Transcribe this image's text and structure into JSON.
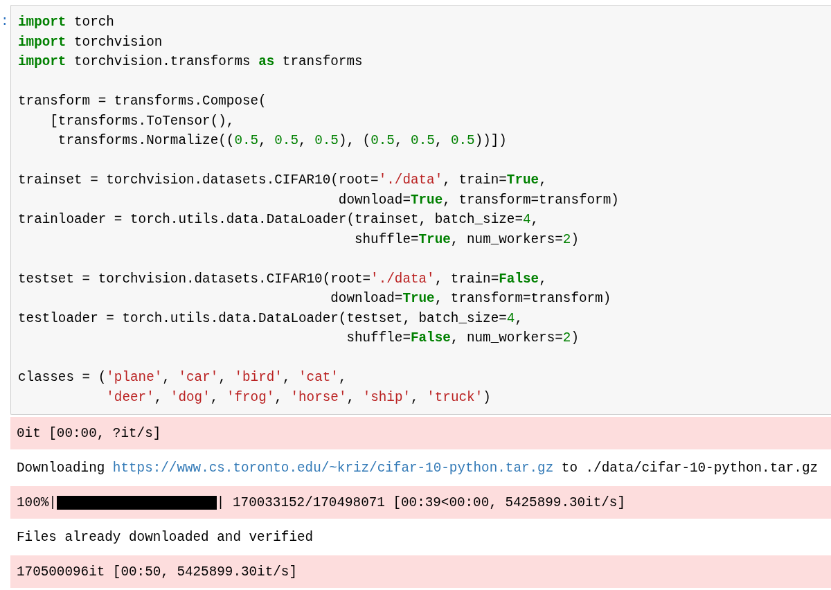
{
  "prompt": ":",
  "code_blocks": [
    [
      [
        {
          "t": "import",
          "kind": "keyword"
        },
        {
          "t": " torch",
          "kind": "plain"
        }
      ],
      [
        {
          "t": "import",
          "kind": "keyword"
        },
        {
          "t": " torchvision",
          "kind": "plain"
        }
      ],
      [
        {
          "t": "import",
          "kind": "keyword"
        },
        {
          "t": " torchvision.transforms ",
          "kind": "plain"
        },
        {
          "t": "as",
          "kind": "keyword"
        },
        {
          "t": " transforms",
          "kind": "plain"
        }
      ]
    ],
    [
      [
        {
          "t": "transform = transforms.Compose(",
          "kind": "plain"
        }
      ],
      [
        {
          "t": "    [transforms.ToTensor(),",
          "kind": "plain"
        }
      ],
      [
        {
          "t": "     transforms.Normalize((",
          "kind": "plain"
        },
        {
          "t": "0.5",
          "kind": "number"
        },
        {
          "t": ", ",
          "kind": "plain"
        },
        {
          "t": "0.5",
          "kind": "number"
        },
        {
          "t": ", ",
          "kind": "plain"
        },
        {
          "t": "0.5",
          "kind": "number"
        },
        {
          "t": "), (",
          "kind": "plain"
        },
        {
          "t": "0.5",
          "kind": "number"
        },
        {
          "t": ", ",
          "kind": "plain"
        },
        {
          "t": "0.5",
          "kind": "number"
        },
        {
          "t": ", ",
          "kind": "plain"
        },
        {
          "t": "0.5",
          "kind": "number"
        },
        {
          "t": "))])",
          "kind": "plain"
        }
      ]
    ],
    [
      [
        {
          "t": "trainset = torchvision.datasets.CIFAR10(root=",
          "kind": "plain"
        },
        {
          "t": "'./data'",
          "kind": "string"
        },
        {
          "t": ", train=",
          "kind": "plain"
        },
        {
          "t": "True",
          "kind": "keyword"
        },
        {
          "t": ",",
          "kind": "plain"
        }
      ],
      [
        {
          "t": "                                        download=",
          "kind": "plain"
        },
        {
          "t": "True",
          "kind": "keyword"
        },
        {
          "t": ", transform=transform)",
          "kind": "plain"
        }
      ],
      [
        {
          "t": "trainloader = torch.utils.data.DataLoader(trainset, batch_size=",
          "kind": "plain"
        },
        {
          "t": "4",
          "kind": "number"
        },
        {
          "t": ",",
          "kind": "plain"
        }
      ],
      [
        {
          "t": "                                          shuffle=",
          "kind": "plain"
        },
        {
          "t": "True",
          "kind": "keyword"
        },
        {
          "t": ", num_workers=",
          "kind": "plain"
        },
        {
          "t": "2",
          "kind": "number"
        },
        {
          "t": ")",
          "kind": "plain"
        }
      ]
    ],
    [
      [
        {
          "t": "testset = torchvision.datasets.CIFAR10(root=",
          "kind": "plain"
        },
        {
          "t": "'./data'",
          "kind": "string"
        },
        {
          "t": ", train=",
          "kind": "plain"
        },
        {
          "t": "False",
          "kind": "keyword"
        },
        {
          "t": ",",
          "kind": "plain"
        }
      ],
      [
        {
          "t": "                                       download=",
          "kind": "plain"
        },
        {
          "t": "True",
          "kind": "keyword"
        },
        {
          "t": ", transform=transform)",
          "kind": "plain"
        }
      ],
      [
        {
          "t": "testloader = torch.utils.data.DataLoader(testset, batch_size=",
          "kind": "plain"
        },
        {
          "t": "4",
          "kind": "number"
        },
        {
          "t": ",",
          "kind": "plain"
        }
      ],
      [
        {
          "t": "                                         shuffle=",
          "kind": "plain"
        },
        {
          "t": "False",
          "kind": "keyword"
        },
        {
          "t": ", num_workers=",
          "kind": "plain"
        },
        {
          "t": "2",
          "kind": "number"
        },
        {
          "t": ")",
          "kind": "plain"
        }
      ]
    ],
    [
      [
        {
          "t": "classes = (",
          "kind": "plain"
        },
        {
          "t": "'plane'",
          "kind": "string"
        },
        {
          "t": ", ",
          "kind": "plain"
        },
        {
          "t": "'car'",
          "kind": "string"
        },
        {
          "t": ", ",
          "kind": "plain"
        },
        {
          "t": "'bird'",
          "kind": "string"
        },
        {
          "t": ", ",
          "kind": "plain"
        },
        {
          "t": "'cat'",
          "kind": "string"
        },
        {
          "t": ",",
          "kind": "plain"
        }
      ],
      [
        {
          "t": "           'deer'",
          "kind": "string"
        },
        {
          "t": ", ",
          "kind": "plain"
        },
        {
          "t": "'dog'",
          "kind": "string"
        },
        {
          "t": ", ",
          "kind": "plain"
        },
        {
          "t": "'frog'",
          "kind": "string"
        },
        {
          "t": ", ",
          "kind": "plain"
        },
        {
          "t": "'horse'",
          "kind": "string"
        },
        {
          "t": ", ",
          "kind": "plain"
        },
        {
          "t": "'ship'",
          "kind": "string"
        },
        {
          "t": ", ",
          "kind": "plain"
        },
        {
          "t": "'truck'",
          "kind": "string"
        },
        {
          "t": ")",
          "kind": "plain"
        }
      ]
    ]
  ],
  "outputs": [
    {
      "kind": "stderr",
      "text": "0it [00:00, ?it/s]"
    },
    {
      "kind": "stdout",
      "text": "Downloading ",
      "link": "https://www.cs.toronto.edu/~kriz/cifar-10-python.tar.gz",
      "text_after": " to ./data/cifar-10-python.tar.gz"
    },
    {
      "kind": "stderr",
      "text": "100%|",
      "level": 1,
      "text_after": "| 170033152/170498071 [00:39<00:00, 5425899.30it/s]"
    },
    {
      "kind": "stdout",
      "text": "Files already downloaded and verified"
    },
    {
      "kind": "stderr",
      "text": "170500096it [00:50, 5425899.30it/s]"
    }
  ]
}
